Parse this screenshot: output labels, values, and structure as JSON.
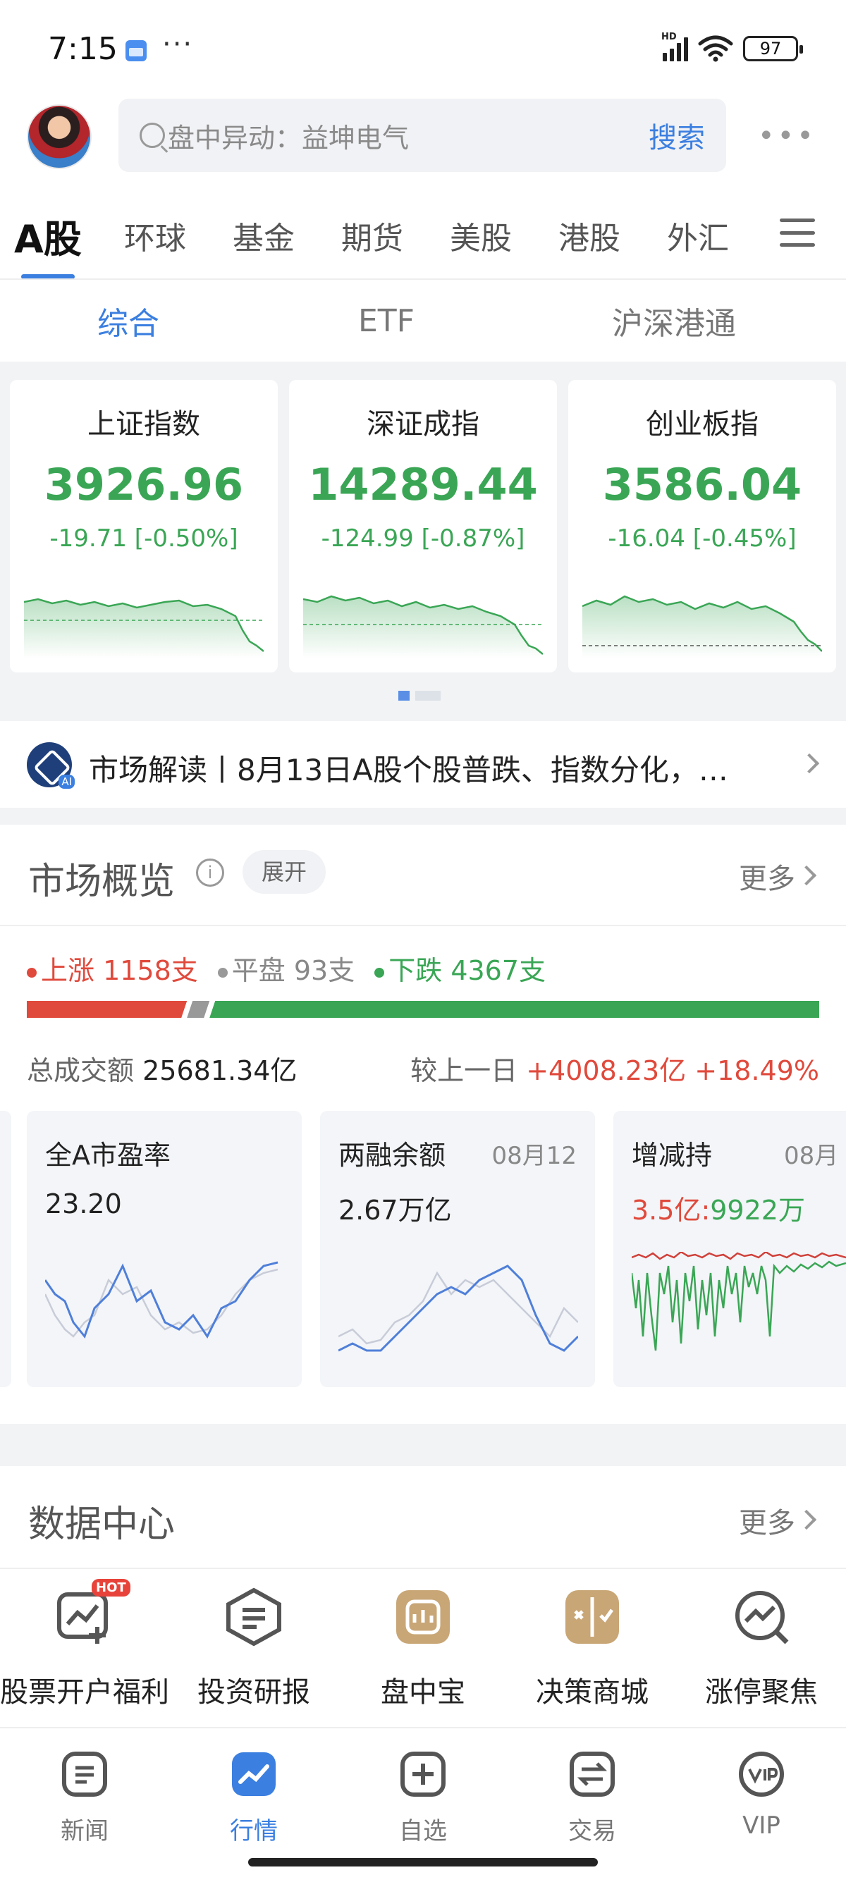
{
  "status_bar": {
    "time": "7:15",
    "more": "···",
    "battery": "97",
    "network": "HD"
  },
  "header": {
    "search_placeholder": "盘中异动：益坤电气",
    "search_button": "搜索",
    "more": "•••"
  },
  "main_tabs": [
    {
      "label": "A股",
      "active": true
    },
    {
      "label": "环球"
    },
    {
      "label": "基金"
    },
    {
      "label": "期货"
    },
    {
      "label": "美股"
    },
    {
      "label": "港股"
    },
    {
      "label": "外汇"
    }
  ],
  "sub_tabs": [
    {
      "label": "综合",
      "active": true
    },
    {
      "label": "ETF"
    },
    {
      "label": "沪深港通"
    }
  ],
  "indices": [
    {
      "name": "上证指数",
      "value": "3926.96",
      "change": "-19.71 [-0.50%]"
    },
    {
      "name": "深证成指",
      "value": "14289.44",
      "change": "-124.99 [-0.87%]"
    },
    {
      "name": "创业板指",
      "value": "3586.04",
      "change": "-16.04 [-0.45%]"
    }
  ],
  "news": {
    "text": "市场解读丨8月13日A股个股普跌、指数分化，…"
  },
  "overview": {
    "title": "市场概览",
    "expand": "展开",
    "more": "更多",
    "up": "上涨 1158支",
    "flat": "平盘 93支",
    "down": "下跌 4367支",
    "up_count": 1158,
    "flat_count": 93,
    "down_count": 4367,
    "turnover_label": "总成交额",
    "turnover_value": "25681.34亿",
    "compare_label": "较上一日",
    "compare_value": "+4008.23亿 +18.49%",
    "cards": [
      {
        "title": "全A市盈率",
        "date": "",
        "value": "23.20"
      },
      {
        "title": "两融余额",
        "date": "08月12",
        "value": "2.67万亿"
      },
      {
        "title": "增减持",
        "date": "08月",
        "value_red": "3.5亿",
        "value_sep": ":",
        "value_green": "9922万"
      }
    ]
  },
  "data_center": {
    "title": "数据中心",
    "more": "更多",
    "items": [
      {
        "label": "股票开户福利",
        "badge": "HOT",
        "icon": "account-chart-icon"
      },
      {
        "label": "投资研报",
        "icon": "report-icon"
      },
      {
        "label": "盘中宝",
        "icon": "treasure-icon"
      },
      {
        "label": "决策商城",
        "icon": "decision-icon"
      },
      {
        "label": "涨停聚焦",
        "icon": "limit-up-icon"
      }
    ]
  },
  "bottom_nav": [
    {
      "label": "新闻",
      "icon": "news-icon"
    },
    {
      "label": "行情",
      "icon": "market-icon",
      "active": true
    },
    {
      "label": "自选",
      "icon": "watchlist-icon"
    },
    {
      "label": "交易",
      "icon": "trade-icon"
    },
    {
      "label": "VIP",
      "icon": "vip-icon"
    }
  ],
  "colors": {
    "accent": "#3b7fe0",
    "up": "#e04a3c",
    "down": "#3aa655",
    "flat": "#999999"
  }
}
